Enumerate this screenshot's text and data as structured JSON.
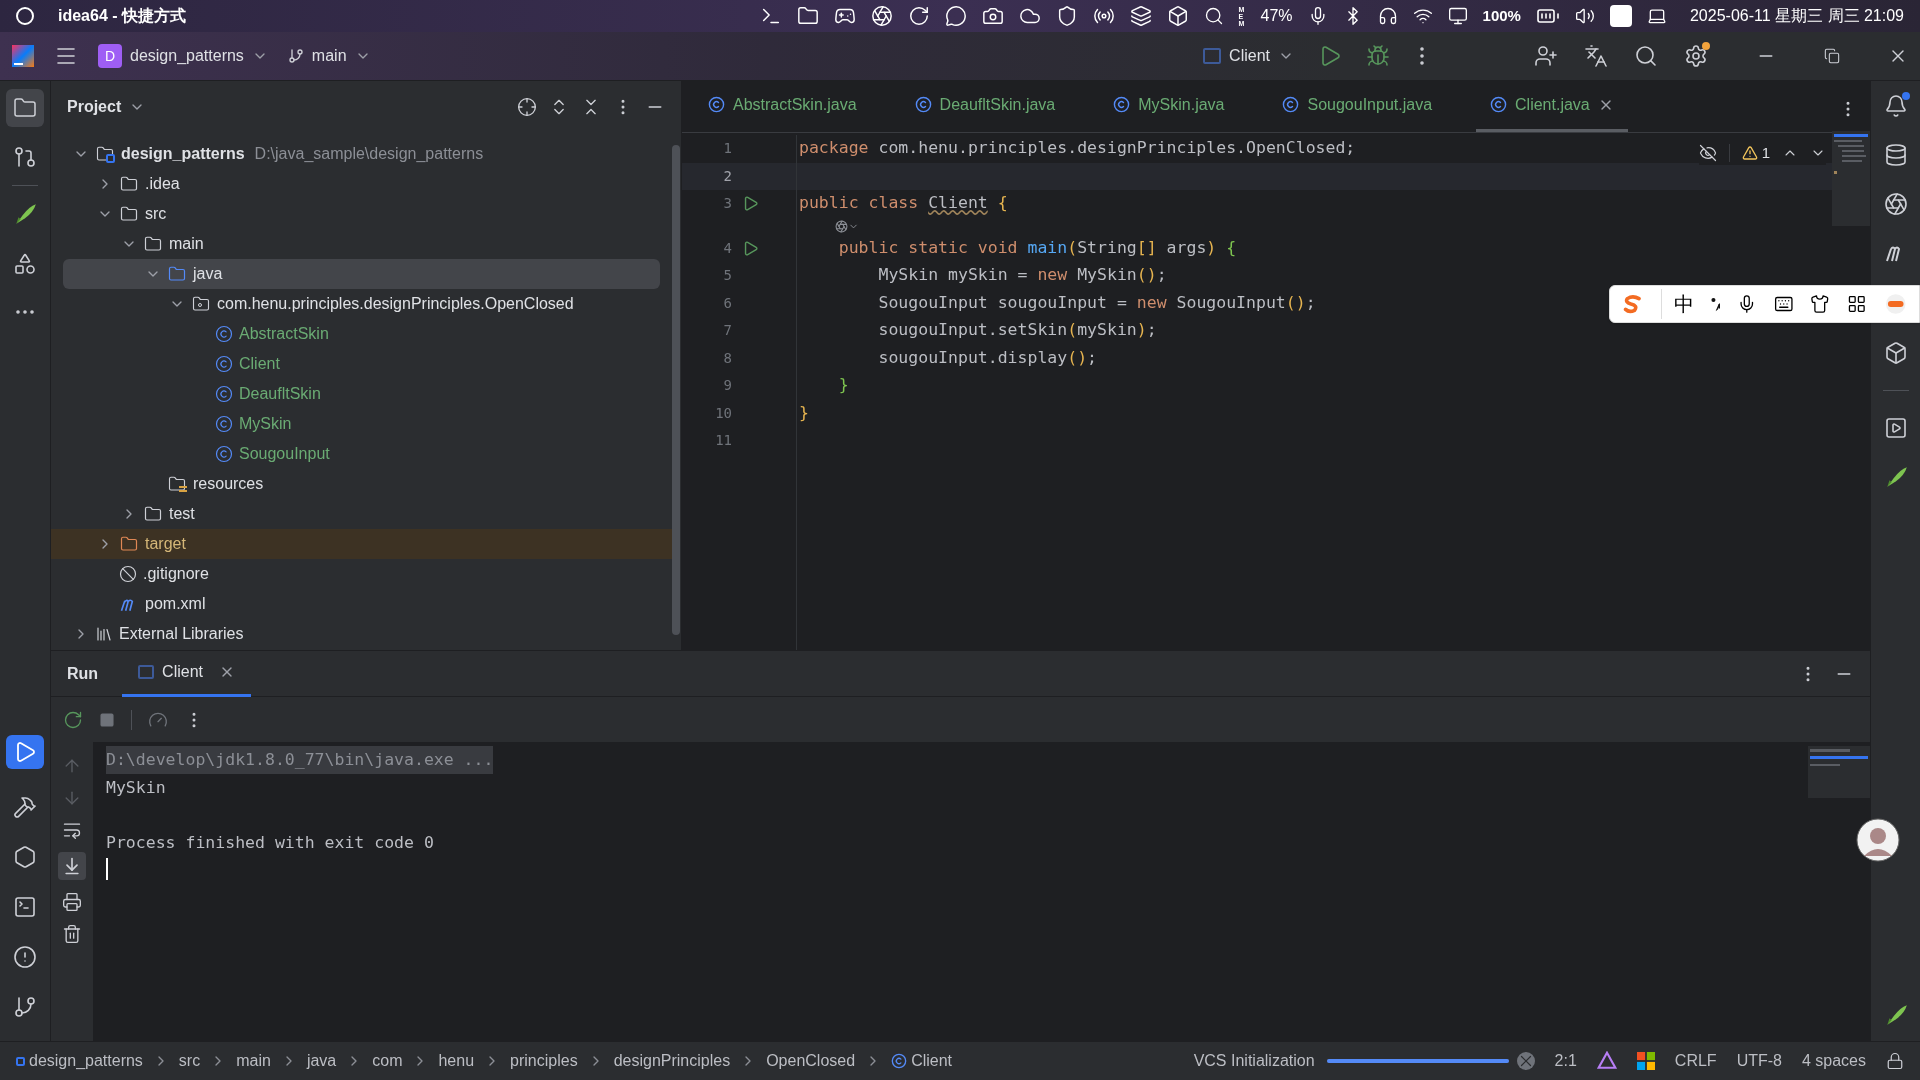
{
  "system_bar": {
    "title": "idea64 - 快捷方式",
    "mem_label": "MEM",
    "mem_percent": "47%",
    "battery": "100%",
    "datetime": "2025-06-11 星期三 周三 21:09"
  },
  "toolbar": {
    "project_badge": "D",
    "project": "design_patterns",
    "branch": "main",
    "run_config": "Client"
  },
  "project_panel": {
    "title": "Project",
    "tree": [
      {
        "kind": "module",
        "label": "design_patterns",
        "path": "D:\\java_sample\\design_patterns",
        "expanded": true,
        "selected": false,
        "children": [
          {
            "kind": "folder",
            "label": ".idea",
            "expanded": false,
            "selected": false
          },
          {
            "kind": "folder",
            "label": "src",
            "expanded": true,
            "selected": false,
            "children": [
              {
                "kind": "folder",
                "label": "main",
                "expanded": true,
                "selected": false,
                "children": [
                  {
                    "kind": "source",
                    "label": "java",
                    "expanded": true,
                    "selected": true,
                    "children": [
                      {
                        "kind": "package",
                        "label": "com.henu.principles.designPrinciples.OpenClosed",
                        "expanded": true,
                        "selected": false,
                        "children": [
                          {
                            "kind": "class",
                            "label": "AbstractSkin",
                            "selected": false
                          },
                          {
                            "kind": "class",
                            "label": "Client",
                            "selected": false
                          },
                          {
                            "kind": "class",
                            "label": "DeaufltSkin",
                            "selected": false
                          },
                          {
                            "kind": "class",
                            "label": "MySkin",
                            "selected": false
                          },
                          {
                            "kind": "class",
                            "label": "SougouInput",
                            "selected": false
                          }
                        ]
                      }
                    ]
                  },
                  {
                    "kind": "resources",
                    "label": "resources",
                    "selected": false
                  }
                ]
              },
              {
                "kind": "folder",
                "label": "test",
                "expanded": false,
                "selected": false
              }
            ]
          },
          {
            "kind": "excluded",
            "label": "target",
            "expanded": false,
            "selected": false
          },
          {
            "kind": "gitignore",
            "label": ".gitignore",
            "selected": false
          },
          {
            "kind": "maven",
            "label": "pom.xml",
            "selected": false
          }
        ]
      },
      {
        "kind": "libraries",
        "label": "External Libraries",
        "expanded": false,
        "selected": false
      }
    ]
  },
  "editor": {
    "tabs": [
      {
        "label": "AbstractSkin.java",
        "selected": false
      },
      {
        "label": "DeaufltSkin.java",
        "selected": false
      },
      {
        "label": "MySkin.java",
        "selected": false
      },
      {
        "label": "SougouInput.java",
        "selected": false
      },
      {
        "label": "Client.java",
        "selected": true
      }
    ],
    "warnings": "1",
    "lines": [
      {
        "number": "1",
        "current": false,
        "runnable": false,
        "tokens": [
          {
            "kind": "kw",
            "t": "package"
          },
          {
            "kind": "plain",
            "t": " com.henu.principles.designPrinciples.OpenClosed;"
          }
        ]
      },
      {
        "number": "2",
        "current": true,
        "runnable": false
      },
      {
        "number": "3",
        "current": false,
        "runnable": true,
        "hint": true,
        "tokens": [
          {
            "kind": "kw",
            "t": "public class "
          },
          {
            "kind": "cls",
            "t": "Client"
          },
          {
            "kind": "b1",
            "t": " {"
          }
        ]
      },
      {
        "number": "4",
        "current": false,
        "runnable": true,
        "tokens": [
          {
            "kind": "kw",
            "t": "    public static void "
          },
          {
            "kind": "fn",
            "t": "main"
          },
          {
            "kind": "b1",
            "t": "("
          },
          {
            "kind": "plain",
            "t": "String"
          },
          {
            "kind": "b1",
            "t": "[]"
          },
          {
            "kind": "plain",
            "t": " args"
          },
          {
            "kind": "b1",
            "t": ")"
          },
          {
            "kind": "b2",
            "t": " {"
          }
        ]
      },
      {
        "number": "5",
        "current": false,
        "runnable": false,
        "tokens": [
          {
            "kind": "plain",
            "t": "        MySkin mySkin = "
          },
          {
            "kind": "kw",
            "t": "new"
          },
          {
            "kind": "plain",
            "t": " MySkin"
          },
          {
            "kind": "b1",
            "t": "()"
          },
          {
            "kind": "plain",
            "t": ";"
          }
        ]
      },
      {
        "number": "6",
        "current": false,
        "runnable": false,
        "tokens": [
          {
            "kind": "plain",
            "t": "        SougouInput sougouInput = "
          },
          {
            "kind": "kw",
            "t": "new"
          },
          {
            "kind": "plain",
            "t": " SougouInput"
          },
          {
            "kind": "b1",
            "t": "()"
          },
          {
            "kind": "plain",
            "t": ";"
          }
        ]
      },
      {
        "number": "7",
        "current": false,
        "runnable": false,
        "tokens": [
          {
            "kind": "plain",
            "t": "        sougouInput.setSkin"
          },
          {
            "kind": "b1",
            "t": "("
          },
          {
            "kind": "plain",
            "t": "mySkin"
          },
          {
            "kind": "b1",
            "t": ")"
          },
          {
            "kind": "plain",
            "t": ";"
          }
        ]
      },
      {
        "number": "8",
        "current": false,
        "runnable": false,
        "tokens": [
          {
            "kind": "plain",
            "t": "        sougouInput.display"
          },
          {
            "kind": "b1",
            "t": "()"
          },
          {
            "kind": "plain",
            "t": ";"
          }
        ]
      },
      {
        "number": "9",
        "current": false,
        "runnable": false,
        "tokens": [
          {
            "kind": "b2",
            "t": "    }"
          }
        ]
      },
      {
        "number": "10",
        "current": false,
        "runnable": false,
        "tokens": [
          {
            "kind": "b1",
            "t": "}"
          }
        ]
      },
      {
        "number": "11",
        "current": false,
        "runnable": false
      }
    ]
  },
  "ime": {
    "mode": "中"
  },
  "run_panel": {
    "title": "Run",
    "tabs": [
      {
        "label": "Client",
        "selected": true
      }
    ],
    "console": [
      {
        "kind": "command",
        "text": "D:\\develop\\jdk1.8.0_77\\bin\\java.exe ..."
      },
      {
        "kind": "output",
        "text": "MySkin"
      },
      {
        "kind": "blank"
      },
      {
        "kind": "output",
        "text": "Process finished with exit code 0"
      }
    ]
  },
  "status_bar": {
    "breadcrumbs": [
      "design_patterns",
      "src",
      "main",
      "java",
      "com",
      "henu",
      "principles",
      "designPrinciples",
      "OpenClosed",
      "Client"
    ],
    "task": "VCS Initialization",
    "level": 1,
    "position": "2:1",
    "line_separator": "CRLF",
    "encoding": "UTF-8",
    "indent": "4 spaces"
  }
}
